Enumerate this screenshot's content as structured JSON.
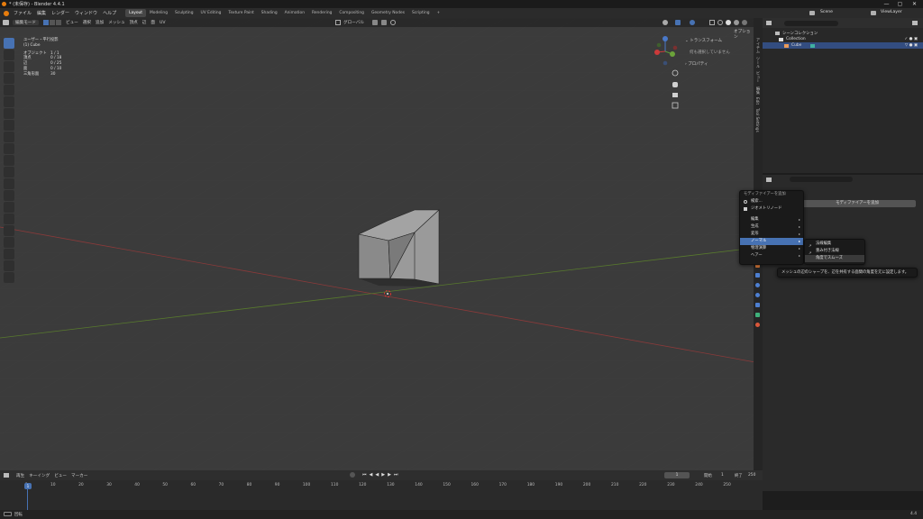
{
  "title": "* (未保存) - Blender 4.4.1",
  "window_controls": [
    "—",
    "▢",
    "✕"
  ],
  "menus": [
    "ファイル",
    "編集",
    "レンダー",
    "ウィンドウ",
    "ヘルプ"
  ],
  "workspace_tabs": [
    "Layout",
    "Modeling",
    "Sculpting",
    "UV Editing",
    "Texture Paint",
    "Shading",
    "Animation",
    "Rendering",
    "Compositing",
    "Geometry Nodes",
    "Scripting"
  ],
  "scene": {
    "label": "Scene",
    "view_layer": "ViewLayer"
  },
  "viewport_header": {
    "mode": "編集モード",
    "menus": [
      "ビュー",
      "選択",
      "追加",
      "メッシュ",
      "頂点",
      "辺",
      "面",
      "UV"
    ],
    "orientation": "グローバル",
    "options": "オプション"
  },
  "viewport_info": {
    "view": "ユーザー・平行投影",
    "object": "(1) Cube",
    "stats": [
      {
        "label": "オブジェクト",
        "value": "1 / 1"
      },
      {
        "label": "頂点",
        "value": "0 / 18"
      },
      {
        "label": "辺",
        "value": "0 / 25"
      },
      {
        "label": "面",
        "value": "0 / 10"
      },
      {
        "label": "三角形面",
        "value": "30"
      }
    ]
  },
  "npanel": {
    "transform": "トランスフォーム",
    "nothing": "何も選択していません",
    "properties": "プロパティ"
  },
  "side_tabs": [
    "アイテム",
    "ツール",
    "ビュー",
    "編集",
    "Edit",
    "Tool Settings"
  ],
  "outliner": {
    "root": "シーンコレクション",
    "collection": "Collection",
    "cube": "Cube"
  },
  "properties": {
    "add_modifier": "モディファイアーを追加"
  },
  "add_modifier_menu": {
    "title": "モディファイアーを追加",
    "search": "検索...",
    "geometry_nodes": "ジオメトリノード",
    "items": [
      "編集",
      "生成",
      "変形",
      "ノーマル",
      "物理演算",
      "ヘアー"
    ]
  },
  "normals_submenu": [
    "法線編集",
    "重み付き法線",
    "角度でスムーズ"
  ],
  "tooltip": "メッシュの辺のシャープを、辺を共有する面間の角度を元に設定します。",
  "timeline": {
    "menus": [
      "再生",
      "キーイング",
      "ビュー",
      "マーカー"
    ],
    "current_frame": "1",
    "start_label": "開始",
    "start": "1",
    "end_label": "終了",
    "end": "250",
    "ticks": [
      "1",
      "10",
      "20",
      "30",
      "40",
      "50",
      "60",
      "70",
      "80",
      "90",
      "100",
      "110",
      "120",
      "130",
      "140",
      "150",
      "160",
      "170",
      "180",
      "190",
      "200",
      "210",
      "220",
      "230",
      "240",
      "250"
    ]
  },
  "status": {
    "left": "回転",
    "right": "4.4"
  }
}
